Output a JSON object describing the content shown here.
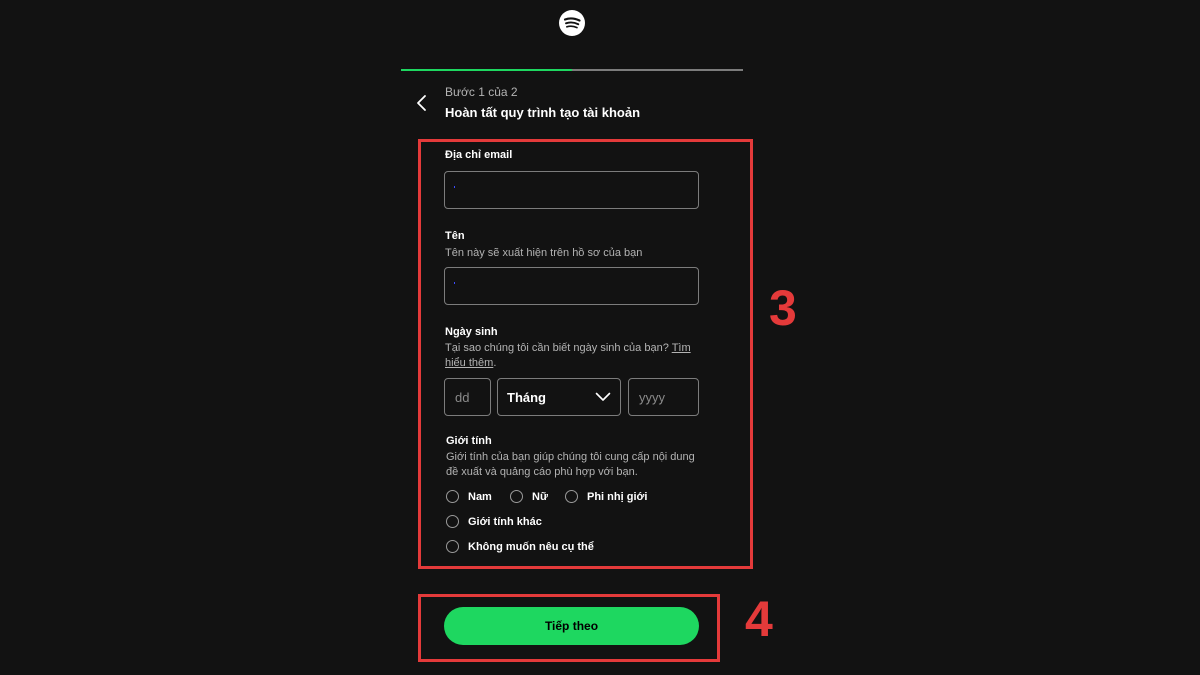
{
  "header": {
    "logo_icon": "spotify-logo-icon",
    "progress": {
      "step_current": 1,
      "step_total": 2,
      "fraction": 0.5,
      "fill_color": "#1ed760"
    },
    "step_label": "Bước 1 của 2",
    "title": "Hoàn tất quy trình tạo tài khoản",
    "back_icon": "chevron-left-icon"
  },
  "form": {
    "email": {
      "label": "Địa chỉ email",
      "value": ""
    },
    "name": {
      "label": "Tên",
      "help": "Tên này sẽ xuất hiện trên hồ sơ của bạn",
      "value": ""
    },
    "birthday": {
      "label": "Ngày sinh",
      "help": "Tại sao chúng tôi cần biết ngày sinh của bạn?",
      "help_link": "Tìm hiểu thêm",
      "day_placeholder": "dd",
      "month_selected": "Tháng",
      "year_placeholder": "yyyy"
    },
    "gender": {
      "label": "Giới tính",
      "help": "Giới tính của bạn giúp chúng tôi cung cấp nội dung đề xuất và quảng cáo phù hợp với bạn.",
      "options": [
        "Nam",
        "Nữ",
        "Phi nhị giới",
        "Giới tính khác",
        "Không muốn nêu cụ thể"
      ]
    }
  },
  "next_button": {
    "label": "Tiếp theo",
    "color": "#1ed760"
  },
  "annotations": {
    "box_color": "#e43a3a",
    "form_number": "3",
    "button_number": "4"
  }
}
